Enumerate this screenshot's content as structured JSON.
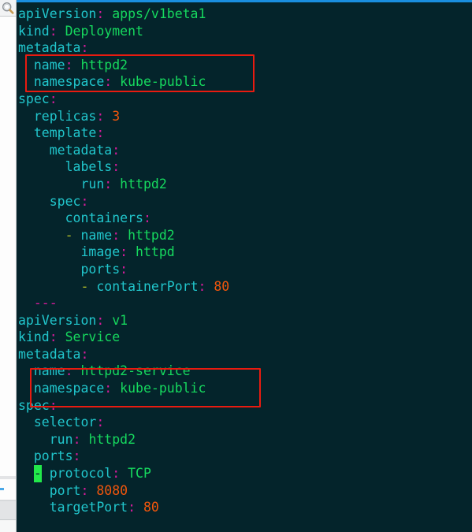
{
  "window": {
    "background_color": "#04242b",
    "accent_rule_color": "#1a8fe0",
    "annotation_color": "#e81b10"
  },
  "sidebar": {
    "icons": [
      {
        "name": "magnifier-icon",
        "label": "Zoom"
      }
    ]
  },
  "editor": {
    "language": "yaml",
    "colors": {
      "key": "#21c6cc",
      "colon": "#d81b9c",
      "string": "#16d95e",
      "number": "#f2560c",
      "dash": "#b3bd28",
      "doc_separator": "#d81b9c",
      "cursor_highlight": "#22e84a"
    },
    "lines": [
      {
        "indent": "",
        "key": "apiVersion",
        "colon": ":",
        "value": "apps/v1beta1",
        "value_type": "string"
      },
      {
        "indent": "",
        "key": "kind",
        "colon": ":",
        "value": "Deployment",
        "value_type": "string"
      },
      {
        "indent": "",
        "key": "metadata",
        "colon": ":",
        "value": "",
        "value_type": "none"
      },
      {
        "indent": "  ",
        "key": "name",
        "colon": ":",
        "value": "httpd2",
        "value_type": "string"
      },
      {
        "indent": "  ",
        "key": "namespace",
        "colon": ":",
        "value": "kube-public",
        "value_type": "string"
      },
      {
        "indent": "",
        "key": "spec",
        "colon": ":",
        "value": "",
        "value_type": "none"
      },
      {
        "indent": "  ",
        "key": "replicas",
        "colon": ":",
        "value": "3",
        "value_type": "number"
      },
      {
        "indent": "  ",
        "key": "template",
        "colon": ":",
        "value": "",
        "value_type": "none"
      },
      {
        "indent": "    ",
        "key": "metadata",
        "colon": ":",
        "value": "",
        "value_type": "none"
      },
      {
        "indent": "      ",
        "key": "labels",
        "colon": ":",
        "value": "",
        "value_type": "none"
      },
      {
        "indent": "        ",
        "key": "run",
        "colon": ":",
        "value": "httpd2",
        "value_type": "string"
      },
      {
        "indent": "    ",
        "key": "spec",
        "colon": ":",
        "value": "",
        "value_type": "none"
      },
      {
        "indent": "      ",
        "key": "containers",
        "colon": ":",
        "value": "",
        "value_type": "none"
      },
      {
        "indent": "      ",
        "dash": "- ",
        "key": "name",
        "colon": ":",
        "value": "httpd2",
        "value_type": "string"
      },
      {
        "indent": "        ",
        "key": "image",
        "colon": ":",
        "value": "httpd",
        "value_type": "string"
      },
      {
        "indent": "        ",
        "key": "ports",
        "colon": ":",
        "value": "",
        "value_type": "none"
      },
      {
        "indent": "        ",
        "dash": "- ",
        "key": "containerPort",
        "colon": ":",
        "value": "80",
        "value_type": "number"
      },
      {
        "indent": "  ",
        "separator": "---"
      },
      {
        "indent": "",
        "key": "apiVersion",
        "colon": ":",
        "value": "v1",
        "value_type": "string"
      },
      {
        "indent": "",
        "key": "kind",
        "colon": ":",
        "value": "Service",
        "value_type": "string"
      },
      {
        "indent": "",
        "key": "metadata",
        "colon": ":",
        "value": "",
        "value_type": "none"
      },
      {
        "indent": "  ",
        "key": "name",
        "colon": ":",
        "value": "httpd2-service",
        "value_type": "string"
      },
      {
        "indent": "  ",
        "key": "namespace",
        "colon": ":",
        "value": "kube-public",
        "value_type": "string"
      },
      {
        "indent": "",
        "key": "spec",
        "colon": ":",
        "value": "",
        "value_type": "none"
      },
      {
        "indent": "  ",
        "key": "selector",
        "colon": ":",
        "value": "",
        "value_type": "none"
      },
      {
        "indent": "    ",
        "key": "run",
        "colon": ":",
        "value": "httpd2",
        "value_type": "string"
      },
      {
        "indent": "  ",
        "key": "ports",
        "colon": ":",
        "value": "",
        "value_type": "none"
      },
      {
        "indent": "  ",
        "dash": "-",
        "cursor_on_dash": true,
        "key": "protocol",
        "colon": ":",
        "value": "TCP",
        "value_type": "string"
      },
      {
        "indent": "    ",
        "key": "port",
        "colon": ":",
        "value": "8080",
        "value_type": "number"
      },
      {
        "indent": "    ",
        "key": "targetPort",
        "colon": ":",
        "value": "80",
        "value_type": "number"
      }
    ]
  },
  "annotations": [
    {
      "name": "redbox-deployment-meta",
      "targets": [
        "name: httpd2",
        "namespace: kube-public"
      ]
    },
    {
      "name": "redbox-service-meta",
      "targets": [
        "name: httpd2-service",
        "namespace: kube-public"
      ]
    }
  ]
}
